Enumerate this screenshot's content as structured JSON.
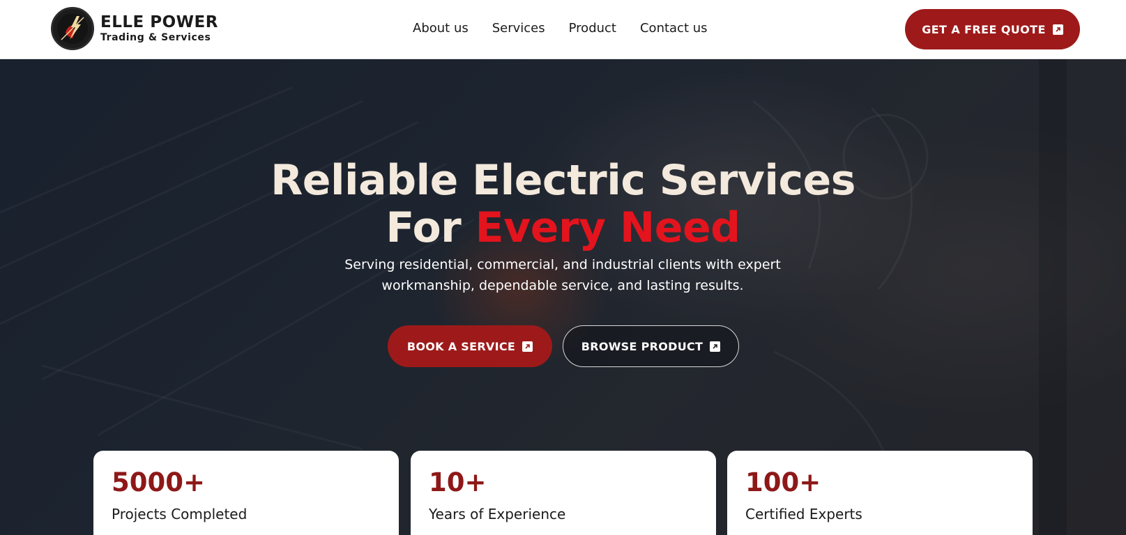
{
  "brand": {
    "title": "ELLE POWER",
    "subtitle": "Trading & Services",
    "accent_color": "#9e1a1a",
    "highlight_color": "#e3141d"
  },
  "nav": {
    "items": [
      {
        "label": "About us"
      },
      {
        "label": "Services"
      },
      {
        "label": "Product"
      },
      {
        "label": "Contact us"
      }
    ],
    "cta_label": "GET A FREE QUOTE",
    "cta_icon": "external-link-icon"
  },
  "hero": {
    "title_line1": "Reliable Electric Services",
    "title_line2_prefix": "For ",
    "title_line2_accent": "Every Need",
    "subtitle": "Serving residential, commercial, and industrial clients with expert workmanship, dependable service, and lasting results.",
    "primary_button": "BOOK A SERVICE",
    "secondary_button": "BROWSE PRODUCT"
  },
  "stats": [
    {
      "value": "5000+",
      "label": "Projects Completed"
    },
    {
      "value": "10+",
      "label": "Years of Experience"
    },
    {
      "value": "100+",
      "label": "Certified Experts"
    }
  ]
}
